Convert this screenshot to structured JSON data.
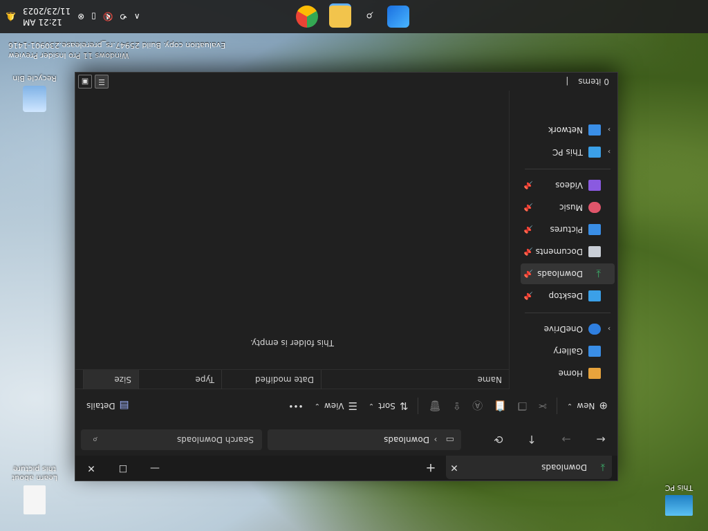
{
  "desktop": {
    "icons": [
      {
        "label": "This PC"
      },
      {
        "label": "Learn about this picture"
      },
      {
        "label": "Recycle Bin"
      }
    ],
    "watermark": {
      "line1": "Windows 11 Pro Insider Preview",
      "line2": "Evaluation copy. Build 25947.rs_prerelease.230901-1416"
    }
  },
  "window": {
    "tab": {
      "label": "Downloads",
      "close": "✕"
    },
    "new_tab": "+",
    "controls": {
      "minimize": "—",
      "maximize": "☐",
      "close": "✕"
    },
    "nav": {
      "back": "←",
      "forward": "→",
      "up": "↑",
      "refresh": "⟳"
    },
    "address": {
      "separator": "›",
      "path": "Downloads"
    },
    "search": {
      "placeholder": "Search Downloads"
    },
    "commands": {
      "new": "New",
      "sort": "Sort",
      "view": "View",
      "more": "•••",
      "details": "Details"
    },
    "sidebar": {
      "items": [
        {
          "label": "Home"
        },
        {
          "label": "Gallery"
        },
        {
          "label": "OneDrive"
        },
        {
          "label": "Desktop"
        },
        {
          "label": "Downloads"
        },
        {
          "label": "Documents"
        },
        {
          "label": "Pictures"
        },
        {
          "label": "Music"
        },
        {
          "label": "Videos"
        },
        {
          "label": "This PC"
        },
        {
          "label": "Network"
        }
      ]
    },
    "columns": {
      "name": "Name",
      "date_modified": "Date modified",
      "type": "Type",
      "size": "Size"
    },
    "empty_message": "This folder is empty.",
    "status": {
      "items": "0 items",
      "separator": "|"
    }
  },
  "taskbar": {
    "clock": {
      "time": "12:21 AM",
      "date": "11/23/2023"
    },
    "chevron": "∧"
  }
}
